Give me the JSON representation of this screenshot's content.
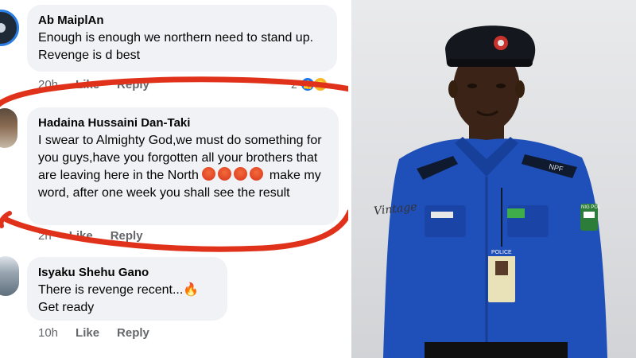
{
  "comments": [
    {
      "author": "Ab MaiplAn",
      "text": "Enough is enough we northern need to stand up. Revenge is d best",
      "time": "20h",
      "like_label": "Like",
      "reply_label": "Reply",
      "reaction_count": "2",
      "reactions": [
        "like-icon",
        "haha-icon"
      ]
    },
    {
      "author": "Hadaina Hussaini Dan-Taki",
      "text_part1": "I swear to Almighty God,we must do something for you guys,have you forgotten all your brothers that are leaving here in the North",
      "text_part2": "make my word, after one week you shall see the result",
      "angry_emoji_count": 4,
      "time": "2h",
      "like_label": "Like",
      "reply_label": "Reply"
    },
    {
      "author": "Isyaku Shehu Gano",
      "text_line1": "There is revenge recent...",
      "text_line2": "Get ready",
      "time": "10h",
      "like_label": "Like",
      "reply_label": "Reply"
    }
  ],
  "photo": {
    "cap_badge_text": "",
    "shoulder_text": "NPF",
    "id_card_text": "POLICE",
    "arm_patch_text": "NIG POL",
    "watermark": "Vintage"
  },
  "colors": {
    "annotation_red": "#e0321b",
    "uniform_blue": "#1f4fb8",
    "fb_link_blue": "#1877f2",
    "bubble_bg": "#f0f2f5"
  }
}
